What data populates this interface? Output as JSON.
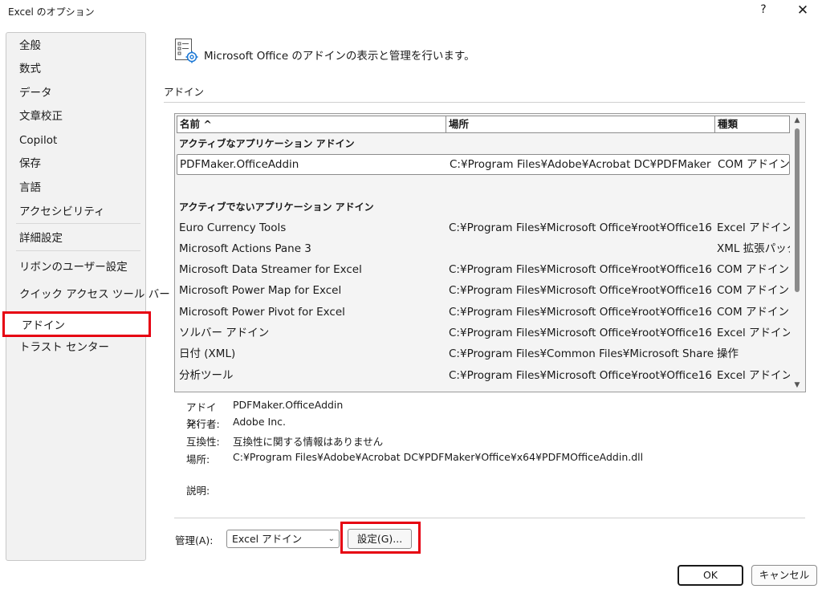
{
  "window": {
    "title": "Excel のオプション",
    "help": "?",
    "close": "✕"
  },
  "sidebar": {
    "items": [
      "全般",
      "数式",
      "データ",
      "文章校正",
      "Copilot",
      "保存",
      "言語",
      "アクセシビリティ",
      "詳細設定",
      "リボンのユーザー設定",
      "クイック アクセス ツール バー",
      "アドイン",
      "トラスト センター"
    ],
    "selected": "アドイン"
  },
  "header": {
    "description": "Microsoft Office のアドインの表示と管理を行います。"
  },
  "section": {
    "title": "アドイン"
  },
  "table": {
    "columns": [
      "名前 ^",
      "場所",
      "種類"
    ],
    "groups": [
      "アクティブなアプリケーション アドイン",
      "アクティブでないアプリケーション アドイン"
    ],
    "active_rows": [
      [
        "PDFMaker.OfficeAddin",
        "C:¥Program Files¥Adobe¥Acrobat DC¥PDFMaker",
        "COM アドイン"
      ]
    ],
    "inactive_rows": [
      [
        "Euro Currency Tools",
        "C:¥Program Files¥Microsoft Office¥root¥Office16",
        "Excel アドイン"
      ],
      [
        "Microsoft Actions Pane 3",
        "",
        "XML 拡張パック"
      ],
      [
        "Microsoft Data Streamer for Excel",
        "C:¥Program Files¥Microsoft Office¥root¥Office16",
        "COM アドイン"
      ],
      [
        "Microsoft Power Map for Excel",
        "C:¥Program Files¥Microsoft Office¥root¥Office16",
        "COM アドイン"
      ],
      [
        "Microsoft Power Pivot for Excel",
        "C:¥Program Files¥Microsoft Office¥root¥Office16",
        "COM アドイン"
      ],
      [
        "ソルバー アドイン",
        "C:¥Program Files¥Microsoft Office¥root¥Office16",
        "Excel アドイン"
      ],
      [
        "日付 (XML)",
        "C:¥Program Files¥Common Files¥Microsoft Share",
        "操作"
      ],
      [
        "分析ツール",
        "C:¥Program Files¥Microsoft Office¥root¥Office16",
        "Excel アドイン"
      ]
    ],
    "scroll_up": "▲",
    "scroll_down": "▼"
  },
  "details": {
    "addin_label": "アドイン:",
    "addin_value": "PDFMaker.OfficeAddin",
    "publisher_label": "発行者:",
    "publisher_value": "Adobe Inc.",
    "compat_label": "互換性:",
    "compat_value": "互換性に関する情報はありません",
    "location_label": "場所:",
    "location_value": "C:¥Program Files¥Adobe¥Acrobat DC¥PDFMaker¥Office¥x64¥PDFMOfficeAddin.dll",
    "description_label": "説明:"
  },
  "manage": {
    "label": "管理(A):",
    "selected": "Excel アドイン",
    "chevron": "⌄",
    "settings_button": "設定(G)..."
  },
  "footer": {
    "ok": "OK",
    "cancel": "キャンセル"
  },
  "colors": {
    "highlight_red": "#e60012",
    "icon_blue": "#1f7ad6"
  }
}
